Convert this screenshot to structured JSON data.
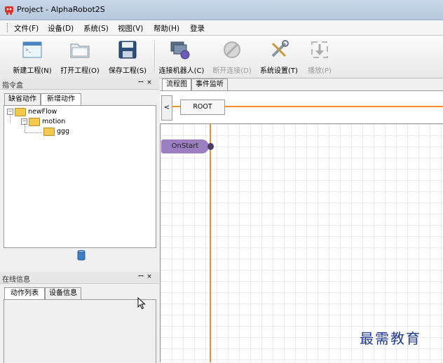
{
  "window": {
    "title": "Project - AlphaRobot2S"
  },
  "menu": {
    "items": [
      "文件(F)",
      "设备(D)",
      "系统(S)",
      "视图(V)",
      "帮助(H)",
      "登录"
    ]
  },
  "toolbar": {
    "new_project": "新建工程(N)",
    "open_project": "打开工程(O)",
    "save_project": "保存工程(S)",
    "connect_robot": "连接机器人(C)",
    "disconnect": "断开连接(D)",
    "system_settings": "系统设置(T)",
    "play": "播放(P)"
  },
  "command_box": {
    "title": "指令盒",
    "pin": "꜒",
    "close": "×",
    "tabs": [
      "缺省动作",
      "新增动作"
    ],
    "tree": [
      "newFlow",
      "motion",
      "ggg"
    ]
  },
  "online_info": {
    "title": "在线信息",
    "pin": "꜒",
    "close": "×",
    "tabs": [
      "动作列表",
      "设备信息"
    ]
  },
  "editor": {
    "tabs": [
      "流程图",
      "事件监听"
    ],
    "back_arrow": "<",
    "root_label": "ROOT",
    "start_node": "OnStart"
  },
  "watermark": "最需教育",
  "colors": {
    "accent_orange": "#f0902a",
    "node_purple": "#9b7fc0"
  }
}
